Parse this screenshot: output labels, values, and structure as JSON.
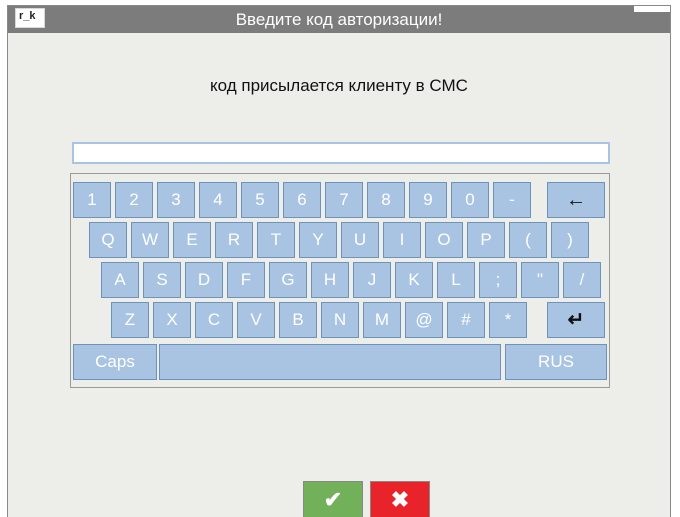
{
  "app": {
    "logo": "r_k",
    "title": "Введите код авторизации!"
  },
  "subtitle": "код присылается клиенту в СМС",
  "input": {
    "value": "",
    "placeholder": ""
  },
  "keyboard": {
    "row1": [
      "1",
      "2",
      "3",
      "4",
      "5",
      "6",
      "7",
      "8",
      "9",
      "0",
      "-"
    ],
    "row2": [
      "Q",
      "W",
      "E",
      "R",
      "T",
      "Y",
      "U",
      "I",
      "O",
      "P",
      "(",
      ")"
    ],
    "row3": [
      "A",
      "S",
      "D",
      "F",
      "G",
      "H",
      "J",
      "K",
      "L",
      ";",
      "\"",
      "/"
    ],
    "row4": [
      "Z",
      "X",
      "C",
      "V",
      "B",
      "N",
      "M",
      "@",
      "#",
      "*"
    ],
    "caps_label": "Caps",
    "lang_label": "RUS",
    "backspace_icon": "backspace-arrow-icon",
    "enter_icon": "enter-return-icon"
  },
  "actions": {
    "ok_icon": "check-icon",
    "ok_glyph": "✔",
    "cancel_icon": "close-icon",
    "cancel_glyph": "✖"
  },
  "colors": {
    "key": "#a9c4e3",
    "titlebar": "#7c7c7c",
    "ok": "#72b05a",
    "cancel": "#e8242a"
  }
}
